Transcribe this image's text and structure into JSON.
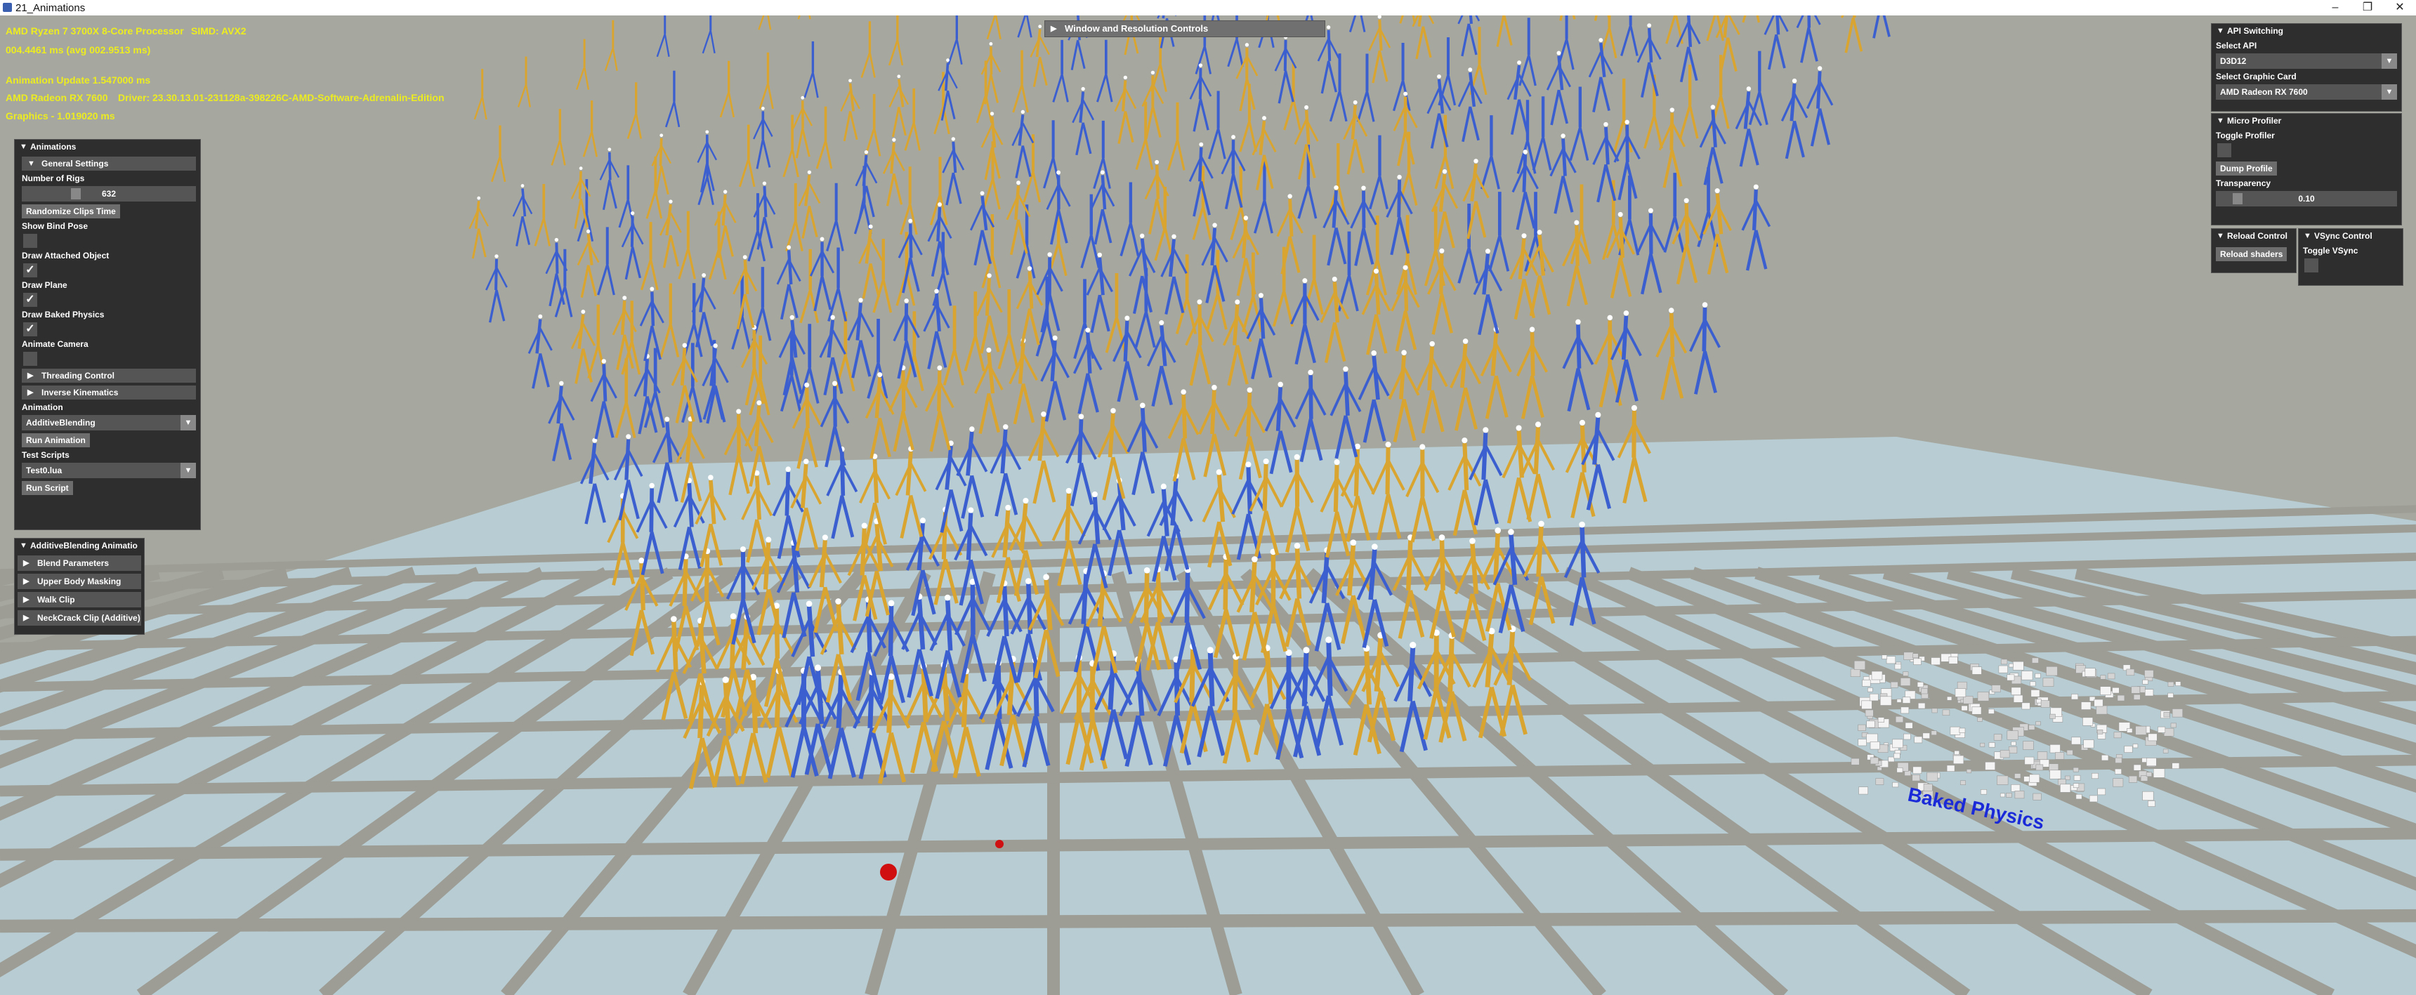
{
  "window": {
    "title": "21_Animations",
    "controls": [
      "–",
      "❐",
      "✕"
    ]
  },
  "hud": {
    "cpu": "AMD Ryzen 7 3700X 8-Core Processor",
    "simd": "SIMD: AVX2",
    "frame_time": "004.4461 ms (avg 002.9513 ms)",
    "animation_update": "Animation Update 1.547000 ms",
    "gpu": "AMD Radeon RX 7600",
    "driver": "Driver: 23.30.13.01-231128a-398226C-AMD-Software-Adrenalin-Edition",
    "graphics": "Graphics - 1.019020 ms"
  },
  "window_resolution": {
    "label": "Window and Resolution Controls"
  },
  "animations_panel": {
    "title": "Animations",
    "general_settings": "General Settings",
    "number_of_rigs_label": "Number of Rigs",
    "number_of_rigs_value": "632",
    "number_of_rigs_fraction": 0.3,
    "randomize_button": "Randomize Clips Time",
    "show_bind_pose": {
      "label": "Show Bind Pose",
      "checked": false
    },
    "draw_attached_object": {
      "label": "Draw Attached Object",
      "checked": true
    },
    "draw_plane": {
      "label": "Draw Plane",
      "checked": true
    },
    "draw_baked_physics": {
      "label": "Draw Baked Physics",
      "checked": true
    },
    "animate_camera": {
      "label": "Animate Camera",
      "checked": false
    },
    "threading_control": "Threading Control",
    "inverse_kinematics": "Inverse Kinematics",
    "animation_label": "Animation",
    "animation_value": "AdditiveBlending",
    "run_animation": "Run Animation",
    "test_scripts_label": "Test Scripts",
    "test_scripts_value": "Test0.lua",
    "run_script": "Run Script"
  },
  "additive_panel": {
    "title": "AdditiveBlending Animatio",
    "sections": [
      "Blend Parameters",
      "Upper Body Masking",
      "Walk Clip",
      "NeckCrack Clip (Additive)"
    ]
  },
  "api_panel": {
    "title": "API Switching",
    "select_api_label": "Select API",
    "select_api_value": "D3D12",
    "select_card_label": "Select Graphic Card",
    "select_card_value": "AMD Radeon RX 7600"
  },
  "profiler_panel": {
    "title": "Micro Profiler",
    "toggle_label": "Toggle Profiler",
    "dump_button": "Dump Profile",
    "transparency_label": "Transparency",
    "transparency_value": "0.10",
    "transparency_fraction": 0.1
  },
  "reload_panel": {
    "title": "Reload Control",
    "button": "Reload shaders"
  },
  "vsync_panel": {
    "title": "VSync Control",
    "toggle_label": "Toggle VSync"
  },
  "scene": {
    "baked_physics_label": "Baked Physics",
    "colors": {
      "background": "#a6a89f",
      "floor": "#b7cdd3",
      "grid": "#9d9d95",
      "rig_blue": "#3c5fd0",
      "rig_gold": "#d9a530",
      "hud_text": "#ecec20",
      "label_blue": "#1a2ad8"
    }
  }
}
